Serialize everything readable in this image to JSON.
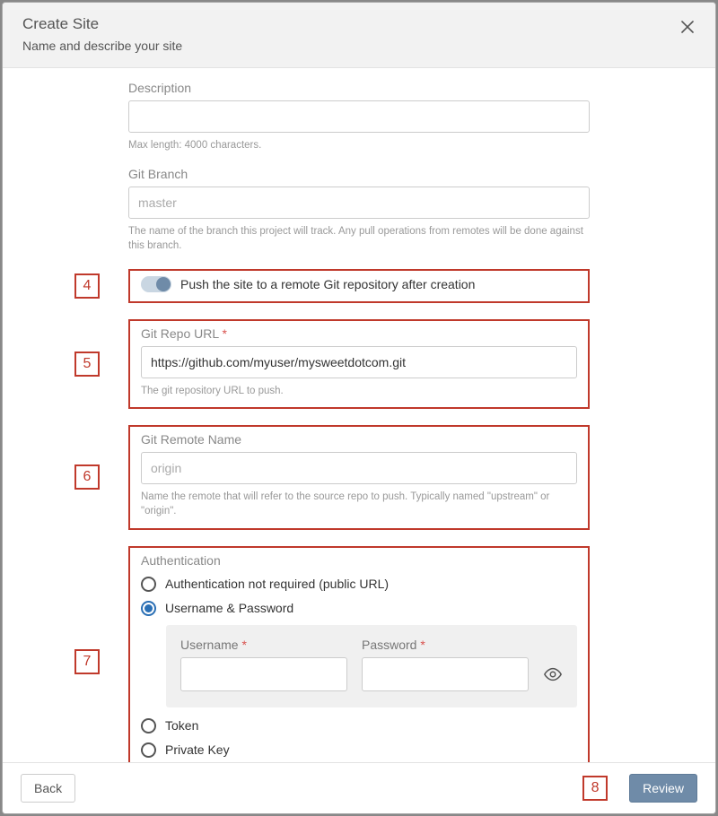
{
  "header": {
    "title": "Create Site",
    "subtitle": "Name and describe your site"
  },
  "description": {
    "label": "Description",
    "value": "",
    "help": "Max length: 4000 characters."
  },
  "gitBranch": {
    "label": "Git Branch",
    "placeholder": "master",
    "value": "",
    "help": "The name of the branch this project will track. Any pull operations from remotes will be done against this branch."
  },
  "callouts": {
    "pushToggle": "4",
    "repoUrl": "5",
    "remoteName": "6",
    "auth": "7",
    "review": "8"
  },
  "pushToggle": {
    "label": "Push the site to a remote Git repository after creation"
  },
  "gitRepoUrl": {
    "label": "Git Repo URL",
    "value": "https://github.com/myuser/mysweetdotcom.git",
    "help": "The git repository URL to push."
  },
  "gitRemoteName": {
    "label": "Git Remote Name",
    "placeholder": "origin",
    "value": "",
    "help": "Name the remote that will refer to the source repo to push. Typically named \"upstream\" or \"origin\"."
  },
  "auth": {
    "label": "Authentication",
    "options": {
      "none": "Authentication not required (public URL)",
      "userpass": "Username & Password",
      "token": "Token",
      "privatekey": "Private Key"
    },
    "selected": "userpass",
    "username": {
      "label": "Username",
      "value": ""
    },
    "password": {
      "label": "Password",
      "value": ""
    }
  },
  "footer": {
    "back": "Back",
    "review": "Review"
  }
}
